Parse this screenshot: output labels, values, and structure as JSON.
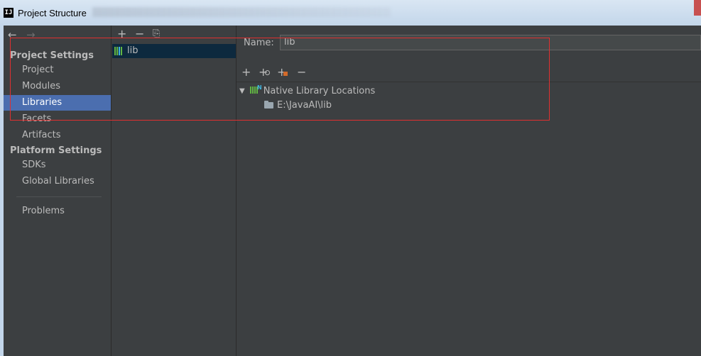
{
  "window": {
    "title": "Project Structure",
    "app_icon": "IJ"
  },
  "sidebar": {
    "back_icon": "←",
    "forward_icon": "→",
    "sections": [
      {
        "header": "Project Settings",
        "items": [
          "Project",
          "Modules",
          "Libraries",
          "Facets",
          "Artifacts"
        ]
      },
      {
        "header": "Platform Settings",
        "items": [
          "SDKs",
          "Global Libraries"
        ]
      }
    ],
    "problems": "Problems",
    "selected": "Libraries"
  },
  "libraries_toolbar": {
    "add": "+",
    "remove": "−",
    "copy": "⎘"
  },
  "library_list": [
    {
      "name": "lib"
    }
  ],
  "detail": {
    "name_label": "Name:",
    "name_value": "lib",
    "toolbar": {
      "add": "+",
      "add_alt": "+",
      "add_jar": "+",
      "remove": "−"
    },
    "tree": {
      "root_label": "Native Library Locations",
      "children": [
        {
          "path": "E:\\JavaAI\\lib"
        }
      ]
    }
  },
  "colors": {
    "background": "#3c3f41",
    "selection": "#4b6eaf",
    "list_selection": "#0d293e",
    "annotation": "#e03030",
    "library_icon_green": "#62b543",
    "library_icon_blue": "#40b6e0"
  }
}
